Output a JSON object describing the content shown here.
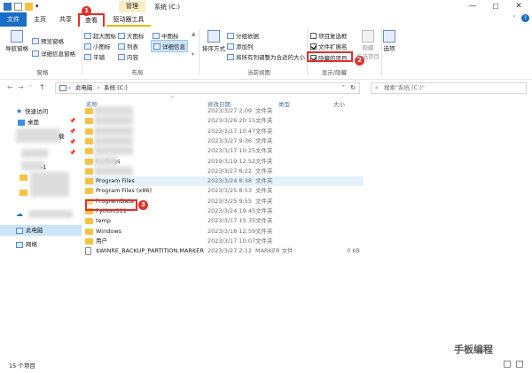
{
  "window": {
    "title": "系统 (C:)",
    "manage_tab": "管理",
    "min": "—",
    "max": "☐",
    "close": "✕",
    "help": "?"
  },
  "tabs": {
    "file": "文件",
    "home": "主页",
    "share": "共享",
    "view": "查看",
    "drive_tools": "驱动器工具"
  },
  "ribbon": {
    "nav_pane": "导航窗格",
    "preview_pane": "预览窗格",
    "details_pane": "详细信息窗格",
    "group_panes": "窗格",
    "extra_large": "超大图标",
    "large": "大图标",
    "medium": "中图标",
    "small": "小图标",
    "list": "列表",
    "details": "详细信息",
    "tiles": "平铺",
    "content": "内容",
    "group_layout": "布局",
    "sort_by": "排序方式",
    "group_by": "分组依据",
    "add_columns": "添加列",
    "size_all_columns": "将所有列调整为合适的大小",
    "group_current_view": "当前视图",
    "item_checkboxes": "项目复选框",
    "file_extensions": "文件扩展名",
    "hidden_items": "隐藏的项目",
    "hide_selected": "隐藏",
    "hide_selected_2": "所选项目",
    "group_show_hide": "显示/隐藏",
    "options": "选项"
  },
  "address": {
    "path_pc": "此电脑",
    "path_c": "系统 (C:)",
    "search_placeholder": "搜索\"系统 (C:)\""
  },
  "nav": {
    "quick_access": "快速访问",
    "desktop": "桌面",
    "this_pc": "此电脑",
    "network": "网络",
    "item_partial_1": "载",
    "item_partial_2": "-1"
  },
  "columns": {
    "name": "名称",
    "date": "修改日期",
    "type": "类型",
    "size": "大小"
  },
  "rows": [
    {
      "name": "",
      "date": "2023/3/27 2:09",
      "type": "文件夹",
      "size": "",
      "blurred": true
    },
    {
      "name": "",
      "date": "2023/3/26 20:15",
      "type": "文件夹",
      "size": "",
      "blurred": true
    },
    {
      "name": "",
      "date": "2023/3/17 10:47",
      "type": "文件夹",
      "size": "",
      "blurred": true
    },
    {
      "name": "",
      "date": "2023/3/27 9:36",
      "type": "文件夹",
      "size": "",
      "blurred": true
    },
    {
      "name": "",
      "date": "2023/3/17 10:25",
      "type": "文件夹",
      "size": "",
      "blurred": true
    },
    {
      "name": "PerfLogs",
      "date": "2019/3/19 12:52",
      "type": "文件夹",
      "size": "",
      "blurred": true
    },
    {
      "name": "",
      "date": "2023/3/27 8:22",
      "type": "文件夹",
      "size": "",
      "blurred": true
    },
    {
      "name": "Program Files",
      "date": "2023/3/24 8:38",
      "type": "文件夹",
      "size": "",
      "blurred": false
    },
    {
      "name": "Program Files (x86)",
      "date": "2023/3/25 8:53",
      "type": "文件夹",
      "size": "",
      "blurred": false
    },
    {
      "name": "ProgramData",
      "date": "2023/3/25 9:55",
      "type": "文件夹",
      "size": "",
      "blurred": false
    },
    {
      "name": "Python311",
      "date": "2023/3/24 19:45",
      "type": "文件夹",
      "size": "",
      "blurred": false
    },
    {
      "name": "temp",
      "date": "2023/3/17 15:35",
      "type": "文件夹",
      "size": "",
      "blurred": false
    },
    {
      "name": "Windows",
      "date": "2023/3/18 12:59",
      "type": "文件夹",
      "size": "",
      "blurred": false
    },
    {
      "name": "用户",
      "date": "2023/3/17 10:07",
      "type": "文件夹",
      "size": "",
      "blurred": false
    },
    {
      "name": "$WINRE_BACKUP_PARTITION.MARKER",
      "date": "2023/3/27 2:12",
      "type": "MARKER 文件",
      "size": "0 KB",
      "blurred": false
    }
  ],
  "status": {
    "count": "15 个项目"
  },
  "badges": {
    "b1": "1",
    "b2": "2",
    "b3": "3"
  },
  "watermark": "手板编程"
}
